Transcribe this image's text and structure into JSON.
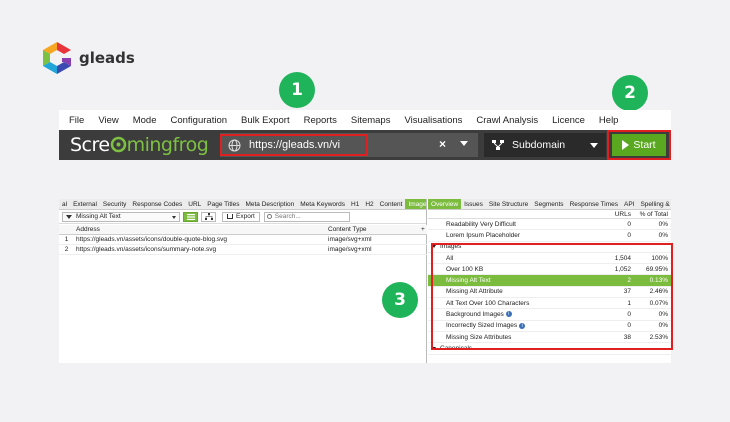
{
  "brand": {
    "name": "gleads"
  },
  "badges": [
    "1",
    "2",
    "3"
  ],
  "menu": [
    "File",
    "View",
    "Mode",
    "Configuration",
    "Bulk Export",
    "Reports",
    "Sitemaps",
    "Visualisations",
    "Crawl Analysis",
    "Licence",
    "Help"
  ],
  "toolbar": {
    "logo_part1": "Scre",
    "logo_part2": "mingfrog",
    "url": "https://gleads.vn/vi",
    "clear_icon": "×",
    "mode": "Subdomain",
    "start_label": "Start"
  },
  "left_tabs": [
    "al",
    "External",
    "Security",
    "Response Codes",
    "URL",
    "Page Titles",
    "Meta Description",
    "Meta Keywords",
    "H1",
    "H2",
    "Content",
    "Images"
  ],
  "filter": {
    "selected": "Missing Alt Text",
    "export_label": "Export",
    "search_placeholder": "Search..."
  },
  "table": {
    "headers": {
      "address": "Address",
      "content_type": "Content Type",
      "plus": "+"
    },
    "rows": [
      {
        "num": "1",
        "address": "https://gleads.vn/assets/icons/double-quote-blog.svg",
        "type": "image/svg+xml"
      },
      {
        "num": "2",
        "address": "https://gleads.vn/assets/icons/summary-note.svg",
        "type": "image/svg+xml"
      }
    ]
  },
  "right_tabs": [
    "Overview",
    "Issues",
    "Site Structure",
    "Segments",
    "Response Times",
    "API",
    "Spelling & G"
  ],
  "overview": {
    "col_urls": "URLs",
    "col_pct": "% of Total",
    "rows": [
      {
        "label": "Readability Very Difficult",
        "urls": "0",
        "pct": "0%",
        "level": 1
      },
      {
        "label": "Lorem Ipsum Placeholder",
        "urls": "0",
        "pct": "0%",
        "level": 1
      },
      {
        "label": "Images",
        "urls": "",
        "pct": "",
        "level": 0,
        "section": true
      },
      {
        "label": "All",
        "urls": "1,504",
        "pct": "100%",
        "level": 1
      },
      {
        "label": "Over 100 KB",
        "urls": "1,052",
        "pct": "69.95%",
        "level": 1
      },
      {
        "label": "Missing Alt Text",
        "urls": "2",
        "pct": "0.13%",
        "level": 1,
        "highlight": true
      },
      {
        "label": "Missing Alt Attribute",
        "urls": "37",
        "pct": "2.46%",
        "level": 1
      },
      {
        "label": "Alt Text Over 100 Characters",
        "urls": "1",
        "pct": "0.07%",
        "level": 1
      },
      {
        "label": "Background Images",
        "urls": "0",
        "pct": "0%",
        "level": 1,
        "info": true
      },
      {
        "label": "Incorrectly Sized Images",
        "urls": "0",
        "pct": "0%",
        "level": 1,
        "info": true
      },
      {
        "label": "Missing Size Attributes",
        "urls": "38",
        "pct": "2.53%",
        "level": 1
      },
      {
        "label": "Canonicals",
        "urls": "",
        "pct": "",
        "level": 0,
        "section": true
      }
    ]
  },
  "colors": {
    "badge": "#1fb35a",
    "highlight": "#7bbb3e",
    "red_box": "#e02020",
    "toolbar": "#3c3c3c"
  }
}
